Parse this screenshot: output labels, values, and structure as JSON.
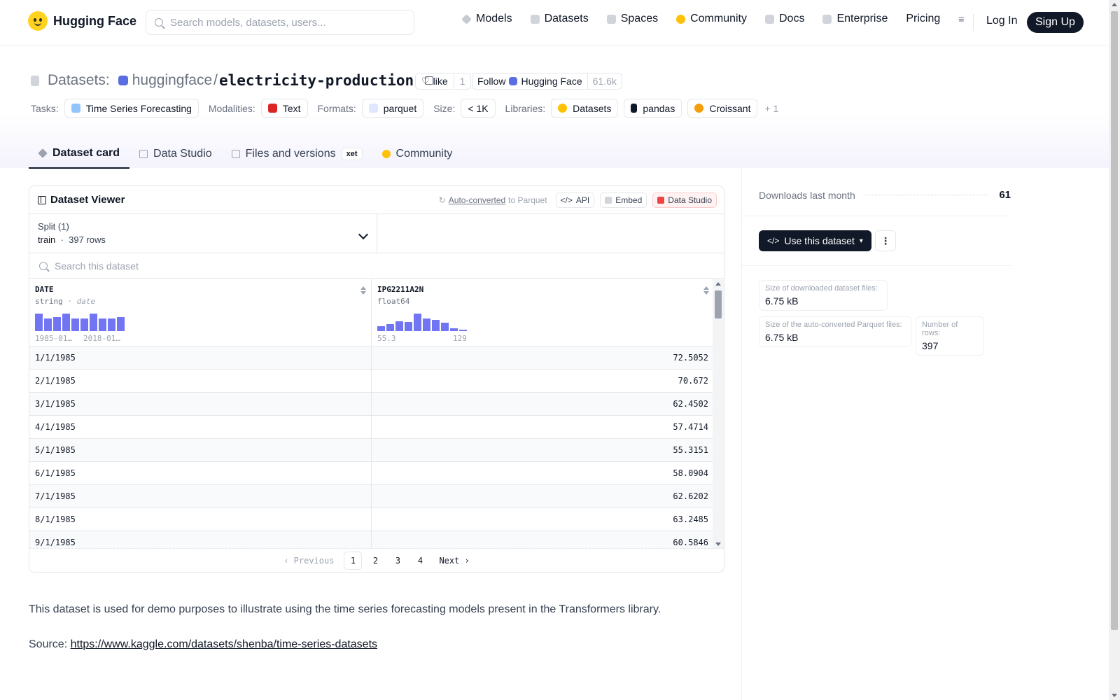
{
  "nav": {
    "brand": "Hugging Face",
    "search_placeholder": "Search models, datasets, users...",
    "links": [
      "Models",
      "Datasets",
      "Spaces",
      "Community",
      "Docs",
      "Enterprise",
      "Pricing"
    ],
    "login": "Log In",
    "signup": "Sign Up"
  },
  "header": {
    "kind": "Datasets:",
    "org": "huggingface",
    "sep": "/",
    "name": "electricity-production",
    "like_label": "like",
    "like_count": "1",
    "follow_label": "Follow",
    "follow_org": "Hugging Face",
    "follow_count": "61.6k",
    "tags": {
      "tasks_label": "Tasks:",
      "task": "Time Series Forecasting",
      "modalities_label": "Modalities:",
      "modality": "Text",
      "formats_label": "Formats:",
      "format": "parquet",
      "size_label": "Size:",
      "size": "< 1K",
      "libraries_label": "Libraries:",
      "libraries": [
        "Datasets",
        "pandas",
        "Croissant"
      ],
      "more": "+ 1"
    },
    "tabs": [
      "Dataset card",
      "Data Studio",
      "Files and versions",
      "Community"
    ],
    "xet_badge": "xet"
  },
  "viewer": {
    "title": "Dataset Viewer",
    "auto_converted": "Auto-converted",
    "to_parquet": "to Parquet",
    "api": "API",
    "embed": "Embed",
    "data_studio": "Data Studio",
    "split_label": "Split (1)",
    "split_name": "train",
    "split_dot": "·",
    "split_rows": "397 rows",
    "search_placeholder": "Search this dataset",
    "columns": [
      {
        "name": "DATE",
        "type": "string",
        "subtype": "· date",
        "hist_min": "1985-01…",
        "hist_max": "2018-01…",
        "hist": [
          0.95,
          0.7,
          0.75,
          0.95,
          0.7,
          0.7,
          0.95,
          0.7,
          0.7,
          0.75
        ]
      },
      {
        "name": "IPG2211A2N",
        "type": "float64",
        "subtype": "",
        "hist_min": "55.3",
        "hist_max": "129",
        "hist": [
          0.25,
          0.4,
          0.55,
          0.5,
          0.95,
          0.7,
          0.6,
          0.45,
          0.15,
          0.05
        ]
      }
    ],
    "rows": [
      [
        "1/1/1985",
        "72.5052"
      ],
      [
        "2/1/1985",
        "70.672"
      ],
      [
        "3/1/1985",
        "62.4502"
      ],
      [
        "4/1/1985",
        "57.4714"
      ],
      [
        "5/1/1985",
        "55.3151"
      ],
      [
        "6/1/1985",
        "58.0904"
      ],
      [
        "7/1/1985",
        "62.6202"
      ],
      [
        "8/1/1985",
        "63.2485"
      ],
      [
        "9/1/1985",
        "60.5846"
      ]
    ],
    "pager": {
      "prev": "Previous",
      "pages": [
        "1",
        "2",
        "3",
        "4"
      ],
      "next": "Next",
      "current": "1"
    }
  },
  "card": {
    "description": "This dataset is used for demo purposes to illustrate using the time series forecasting models present in the Transformers library.",
    "source_label": "Source:",
    "source_link": "https://www.kaggle.com/datasets/shenba/time-series-datasets"
  },
  "sidebar": {
    "downloads_label": "Downloads last month",
    "downloads_value": "61",
    "use_button": "Use this dataset",
    "more_button": "⋮",
    "stats": [
      {
        "label": "Size of downloaded dataset files:",
        "value": "6.75 kB"
      },
      {
        "label": "Size of the auto-converted Parquet files:",
        "value": "6.75 kB"
      },
      {
        "label": "Number of rows:",
        "value": "397"
      }
    ]
  },
  "colors": {
    "accent": "#6366f1",
    "dark": "#111827",
    "brand_yellow": "#ffd21e"
  }
}
